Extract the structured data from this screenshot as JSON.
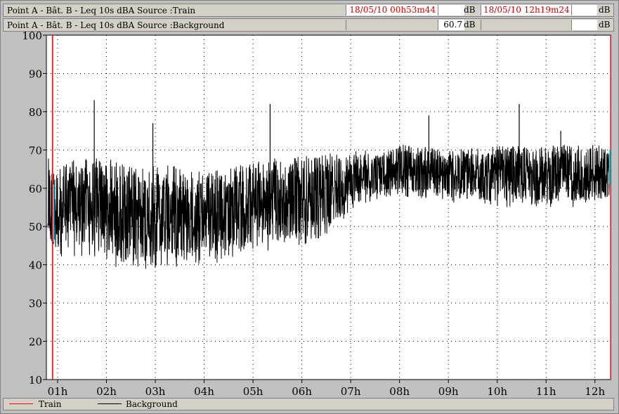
{
  "header": {
    "rows": [
      {
        "label": "Point A - Bât. B -  Leq 10s  dBA  Source :Train",
        "cursor1_time": "18/05/10 00h53m44",
        "cursor1_value": "",
        "cursor1_unit": "dB",
        "cursor2_time": "18/05/10 12h19m24",
        "cursor2_value": "",
        "cursor2_unit": "dB"
      },
      {
        "label": "Point A - Bât. B -  Leq 10s  dBA  Source :Background",
        "cursor1_time": "",
        "cursor1_value": "60.7",
        "cursor1_unit": "dB",
        "cursor2_time": "",
        "cursor2_value": "",
        "cursor2_unit": "dB"
      }
    ]
  },
  "colors": {
    "train": "#ff0000",
    "background": "#000000",
    "cursor_text": "#cc0000",
    "cursor_marker": "#00e0ff"
  },
  "chart_data": {
    "type": "line",
    "ylim": [
      10,
      100
    ],
    "yticks": [
      "10",
      "20",
      "30",
      "40",
      "50",
      "60",
      "70",
      "80",
      "90",
      "100"
    ],
    "xlim": [
      0.77,
      12.32
    ],
    "xticks": [
      {
        "x": 1,
        "label": "01h"
      },
      {
        "x": 2,
        "label": "02h"
      },
      {
        "x": 3,
        "label": "03h"
      },
      {
        "x": 4,
        "label": "04h"
      },
      {
        "x": 5,
        "label": "05h"
      },
      {
        "x": 6,
        "label": "06h"
      },
      {
        "x": 7,
        "label": "07h"
      },
      {
        "x": 8,
        "label": "08h"
      },
      {
        "x": 9,
        "label": "09h"
      },
      {
        "x": 10,
        "label": "10h"
      },
      {
        "x": 11,
        "label": "11h"
      },
      {
        "x": 12,
        "label": "12h"
      }
    ],
    "grid": "dotted",
    "cursors_hours": [
      0.896,
      12.323
    ],
    "series": [
      {
        "name": "Train",
        "color": "#ff0000",
        "points": []
      },
      {
        "name": "Background",
        "color": "#000000",
        "band": [
          {
            "x": 0.8,
            "low": 40,
            "high": 68
          },
          {
            "x": 1.0,
            "low": 42,
            "high": 66
          },
          {
            "x": 1.5,
            "low": 42,
            "high": 68
          },
          {
            "x": 2.0,
            "low": 40,
            "high": 68
          },
          {
            "x": 2.5,
            "low": 38,
            "high": 66
          },
          {
            "x": 3.0,
            "low": 39,
            "high": 66
          },
          {
            "x": 3.5,
            "low": 39,
            "high": 66
          },
          {
            "x": 4.0,
            "low": 40,
            "high": 64
          },
          {
            "x": 4.5,
            "low": 41,
            "high": 66
          },
          {
            "x": 5.0,
            "low": 43,
            "high": 67
          },
          {
            "x": 5.5,
            "low": 44,
            "high": 68
          },
          {
            "x": 6.0,
            "low": 45,
            "high": 69
          },
          {
            "x": 6.5,
            "low": 47,
            "high": 69
          },
          {
            "x": 7.0,
            "low": 54,
            "high": 70
          },
          {
            "x": 7.5,
            "low": 57,
            "high": 70
          },
          {
            "x": 7.9,
            "low": 58,
            "high": 70
          },
          {
            "x": 8.0,
            "low": 58,
            "high": 72
          },
          {
            "x": 8.5,
            "low": 57,
            "high": 71
          },
          {
            "x": 9.0,
            "low": 56,
            "high": 70
          },
          {
            "x": 10.0,
            "low": 55,
            "high": 71
          },
          {
            "x": 11.0,
            "low": 55,
            "high": 71
          },
          {
            "x": 12.0,
            "low": 55,
            "high": 72
          },
          {
            "x": 12.3,
            "low": 56,
            "high": 70
          }
        ],
        "peaks": [
          {
            "x": 1.75,
            "y": 83
          },
          {
            "x": 2.95,
            "y": 77
          },
          {
            "x": 5.35,
            "y": 82
          },
          {
            "x": 8.6,
            "y": 79
          },
          {
            "x": 10.45,
            "y": 82
          },
          {
            "x": 11.3,
            "y": 75
          }
        ]
      }
    ]
  },
  "legend": [
    {
      "label": "Train",
      "color": "#ff0000"
    },
    {
      "label": "Background",
      "color": "#000000"
    }
  ]
}
